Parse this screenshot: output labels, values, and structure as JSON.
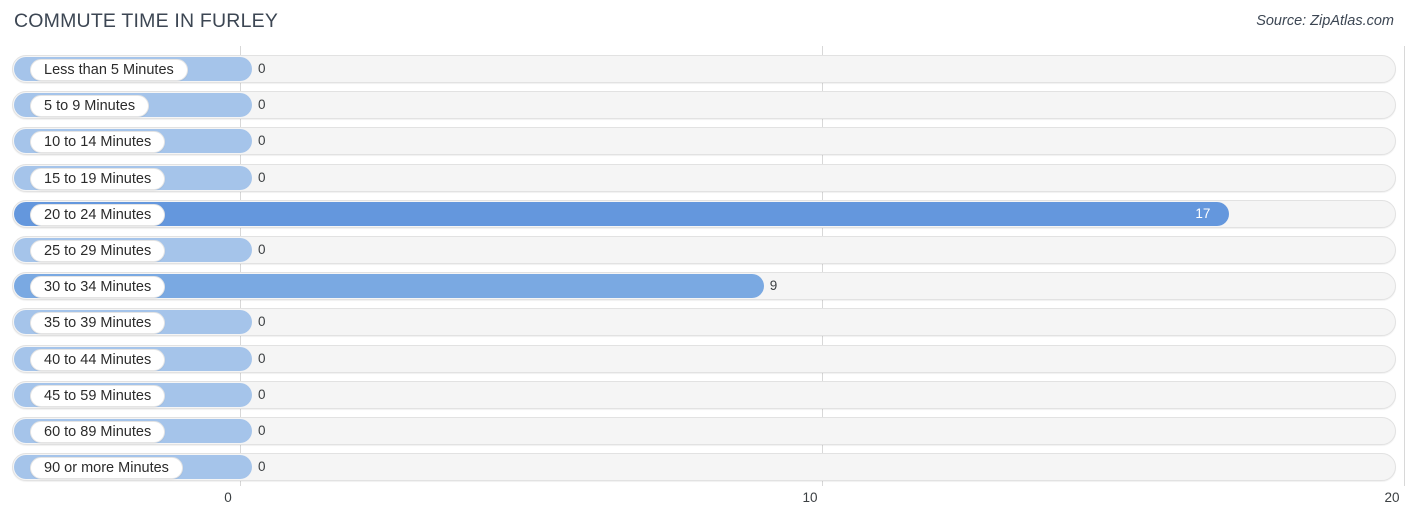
{
  "header": {
    "title": "COMMUTE TIME IN FURLEY",
    "source": "Source: ZipAtlas.com"
  },
  "colors": {
    "bar_filled": "#6497dd",
    "bar_zero": "#a5c4ea",
    "track": "#f5f5f5",
    "gridline": "#d8d8d8",
    "text": "#3c4043"
  },
  "chart_data": {
    "type": "bar",
    "orientation": "horizontal",
    "title": "COMMUTE TIME IN FURLEY",
    "xlabel": "",
    "ylabel": "",
    "xlim": [
      0,
      20
    ],
    "xticks": [
      "0",
      "10",
      "20"
    ],
    "xtick_values": [
      0,
      10,
      20
    ],
    "grid": true,
    "legend": false,
    "categories": [
      "Less than 5 Minutes",
      "5 to 9 Minutes",
      "10 to 14 Minutes",
      "15 to 19 Minutes",
      "20 to 24 Minutes",
      "25 to 29 Minutes",
      "30 to 34 Minutes",
      "35 to 39 Minutes",
      "40 to 44 Minutes",
      "45 to 59 Minutes",
      "60 to 89 Minutes",
      "90 or more Minutes"
    ],
    "values": [
      0,
      0,
      0,
      0,
      17,
      0,
      9,
      0,
      0,
      0,
      0,
      0
    ],
    "value_labels": [
      "0",
      "0",
      "0",
      "0",
      "17",
      "0",
      "9",
      "0",
      "0",
      "0",
      "0",
      "0"
    ]
  },
  "rows": [
    {
      "label": "Less than 5 Minutes",
      "value": 0,
      "value_label": "0",
      "label_inside": false
    },
    {
      "label": "5 to 9 Minutes",
      "value": 0,
      "value_label": "0",
      "label_inside": false
    },
    {
      "label": "10 to 14 Minutes",
      "value": 0,
      "value_label": "0",
      "label_inside": false
    },
    {
      "label": "15 to 19 Minutes",
      "value": 0,
      "value_label": "0",
      "label_inside": false
    },
    {
      "label": "20 to 24 Minutes",
      "value": 17,
      "value_label": "17",
      "label_inside": true
    },
    {
      "label": "25 to 29 Minutes",
      "value": 0,
      "value_label": "0",
      "label_inside": false
    },
    {
      "label": "30 to 34 Minutes",
      "value": 9,
      "value_label": "9",
      "label_inside": false
    },
    {
      "label": "35 to 39 Minutes",
      "value": 0,
      "value_label": "0",
      "label_inside": false
    },
    {
      "label": "40 to 44 Minutes",
      "value": 0,
      "value_label": "0",
      "label_inside": false
    },
    {
      "label": "45 to 59 Minutes",
      "value": 0,
      "value_label": "0",
      "label_inside": false
    },
    {
      "label": "60 to 89 Minutes",
      "value": 0,
      "value_label": "0",
      "label_inside": false
    },
    {
      "label": "90 or more Minutes",
      "value": 0,
      "value_label": "0",
      "label_inside": false
    }
  ],
  "axis": {
    "ticks": [
      {
        "label": "0",
        "value": 0
      },
      {
        "label": "10",
        "value": 10
      },
      {
        "label": "20",
        "value": 20
      }
    ]
  }
}
